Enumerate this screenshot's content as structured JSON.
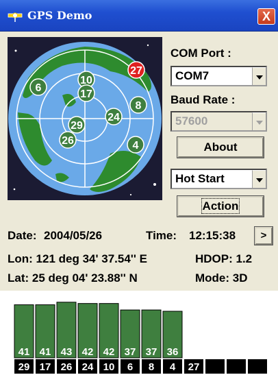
{
  "window": {
    "title": "GPS Demo",
    "close_glyph": "X"
  },
  "sky": {
    "satellites": [
      {
        "prn": "6",
        "highlight": false
      },
      {
        "prn": "10",
        "highlight": false
      },
      {
        "prn": "17",
        "highlight": false
      },
      {
        "prn": "27",
        "highlight": true
      },
      {
        "prn": "8",
        "highlight": false
      },
      {
        "prn": "24",
        "highlight": false
      },
      {
        "prn": "29",
        "highlight": false
      },
      {
        "prn": "26",
        "highlight": false
      },
      {
        "prn": "4",
        "highlight": false
      }
    ],
    "colors": {
      "sky": "#6aa9e8",
      "land": "#2e8b2e",
      "sat": "#3f7f3f",
      "sat_highlight": "#e02020"
    }
  },
  "controls": {
    "com_port_label": "COM Port :",
    "com_port_value": "COM7",
    "baud_rate_label": "Baud Rate :",
    "baud_rate_value": "57600",
    "about_label": "About",
    "start_mode_value": "Hot Start",
    "action_label": "Action"
  },
  "info": {
    "date_label": "Date:",
    "date_value": "2004/05/26",
    "time_label": "Time:",
    "time_value": "12:15:38",
    "next_glyph": ">",
    "lon_line": "Lon: 121 deg 34' 37.54'' E",
    "hdop_line": "HDOP: 1.2",
    "lat_line": "Lat:   25  deg 04' 23.88'' N",
    "mode_line": "Mode:  3D"
  },
  "signal": {
    "max_snr": 45,
    "bars": [
      {
        "prn": "29",
        "snr": 41
      },
      {
        "prn": "17",
        "snr": 41
      },
      {
        "prn": "26",
        "snr": 43
      },
      {
        "prn": "24",
        "snr": 42
      },
      {
        "prn": "10",
        "snr": 42
      },
      {
        "prn": "6",
        "snr": 37
      },
      {
        "prn": "8",
        "snr": 37
      },
      {
        "prn": "4",
        "snr": 36
      }
    ],
    "extra_slots": [
      "27",
      "",
      "",
      ""
    ],
    "colors": {
      "bar": "#3f7f3f",
      "label_bg": "#000000"
    }
  }
}
